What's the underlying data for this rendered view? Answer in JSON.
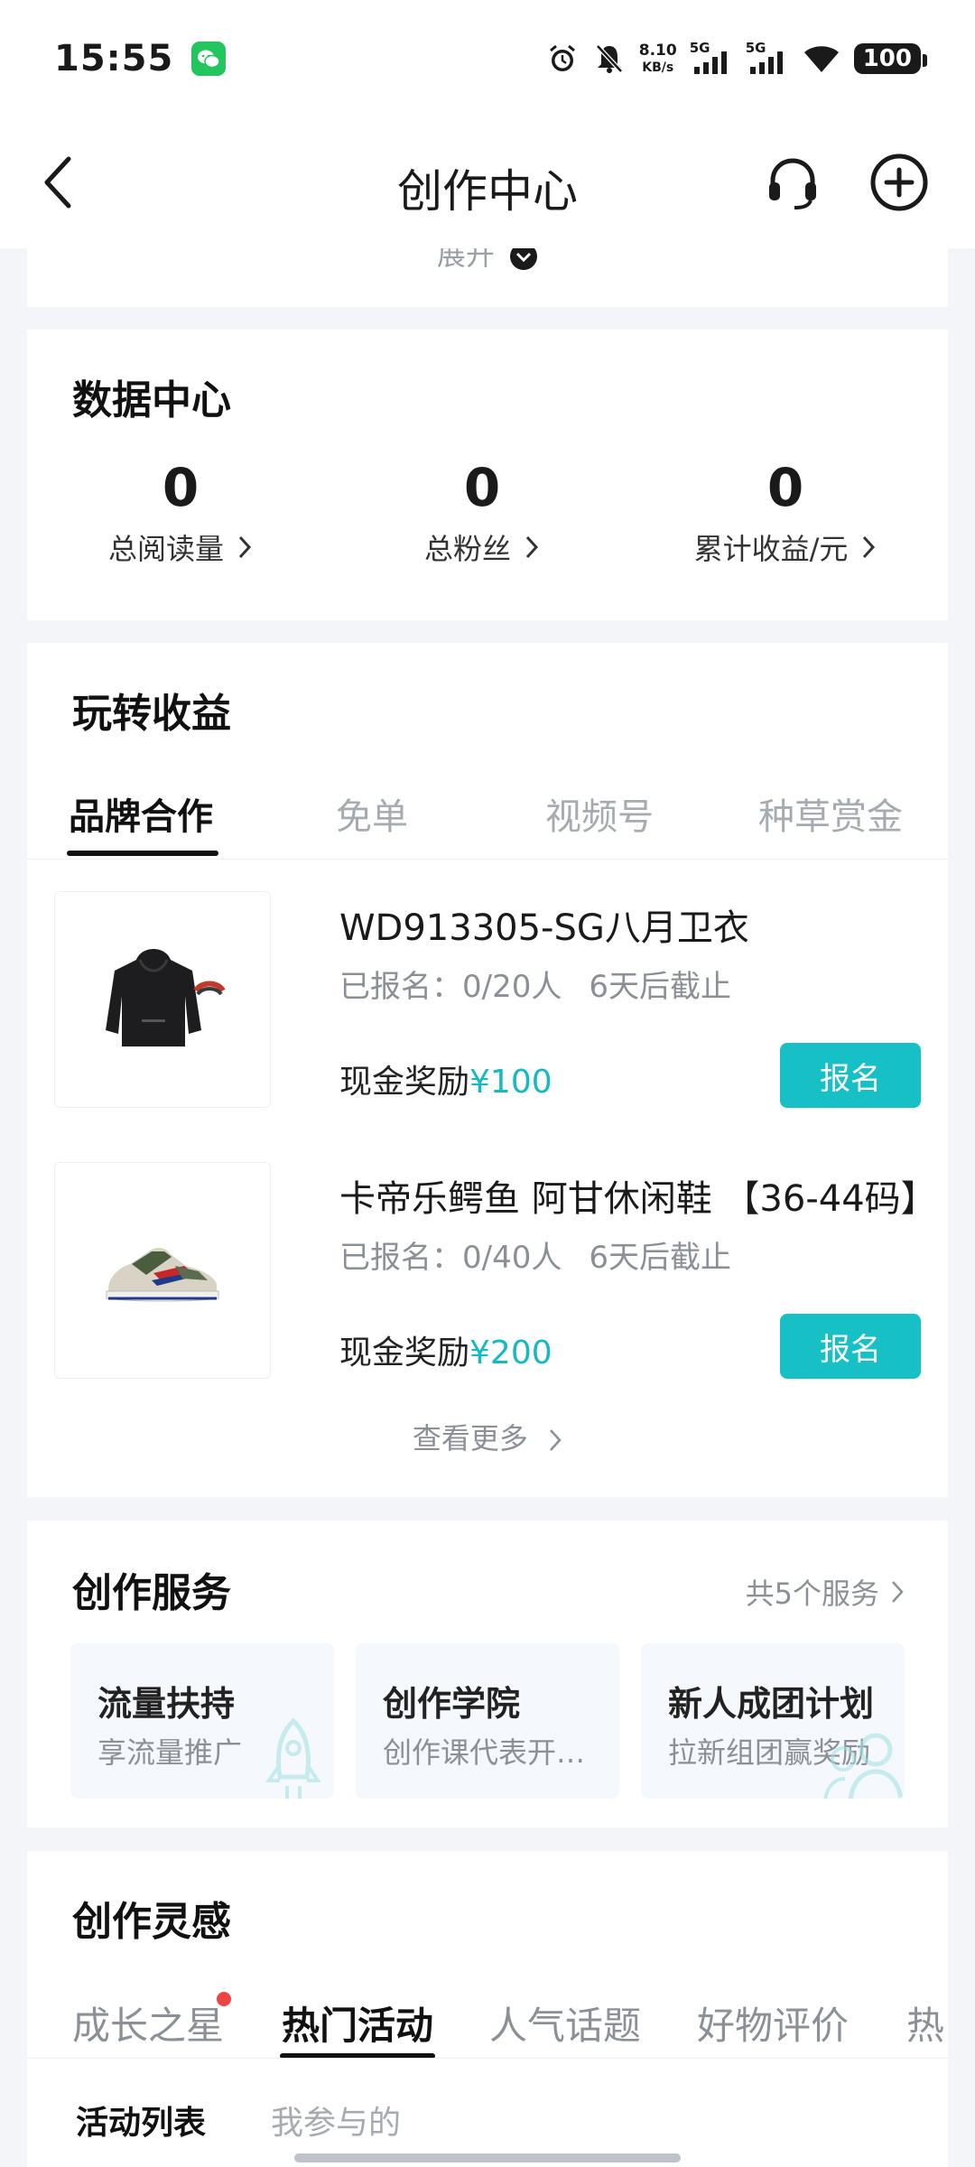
{
  "status_bar": {
    "time": "15:55",
    "net_speed_value": "8.10",
    "net_speed_unit": "KB/s",
    "signal1_label": "5G",
    "signal2_label": "5G",
    "battery": "100"
  },
  "header": {
    "title": "创作中心"
  },
  "collapsed_section": {
    "expand_label": "展开"
  },
  "data_center": {
    "title": "数据中心",
    "stats": [
      {
        "value": "0",
        "label": "总阅读量"
      },
      {
        "value": "0",
        "label": "总粉丝"
      },
      {
        "value": "0",
        "label": "累计收益/元"
      }
    ]
  },
  "earnings": {
    "title": "玩转收益",
    "tabs": [
      "品牌合作",
      "免单",
      "视频号",
      "种草赏金"
    ],
    "active_tab": "品牌合作",
    "products": [
      {
        "title": "WD913305-SG八月卫衣",
        "enrolled": "已报名：0/20人",
        "deadline": "6天后截止",
        "reward_label": "现金奖励",
        "reward_amount": "¥100",
        "button": "报名"
      },
      {
        "title": "卡帝乐鳄鱼 阿甘休闲鞋 【36-44码】",
        "enrolled": "已报名：0/40人",
        "deadline": "6天后截止",
        "reward_label": "现金奖励",
        "reward_amount": "¥200",
        "button": "报名"
      }
    ],
    "see_more": "查看更多"
  },
  "services": {
    "title": "创作服务",
    "count_label": "共5个服务",
    "items": [
      {
        "title": "流量扶持",
        "subtitle": "享流量推广"
      },
      {
        "title": "创作学院",
        "subtitle": "创作课代表开…"
      },
      {
        "title": "新人成团计划",
        "subtitle": "拉新组团赢奖励"
      }
    ]
  },
  "inspiration": {
    "title": "创作灵感",
    "tabs": [
      "成长之星",
      "热门活动",
      "人气话题",
      "好物评价",
      "热"
    ],
    "active_tab": "热门活动",
    "sub_tabs": [
      "活动列表",
      "我参与的"
    ],
    "active_sub_tab": "活动列表"
  },
  "colors": {
    "accent": "#17c0c4",
    "reward_text": "#17b9c0",
    "page_bg": "#f3f5f9",
    "badge_red": "#ef4444",
    "wechat_green": "#22c55e"
  }
}
